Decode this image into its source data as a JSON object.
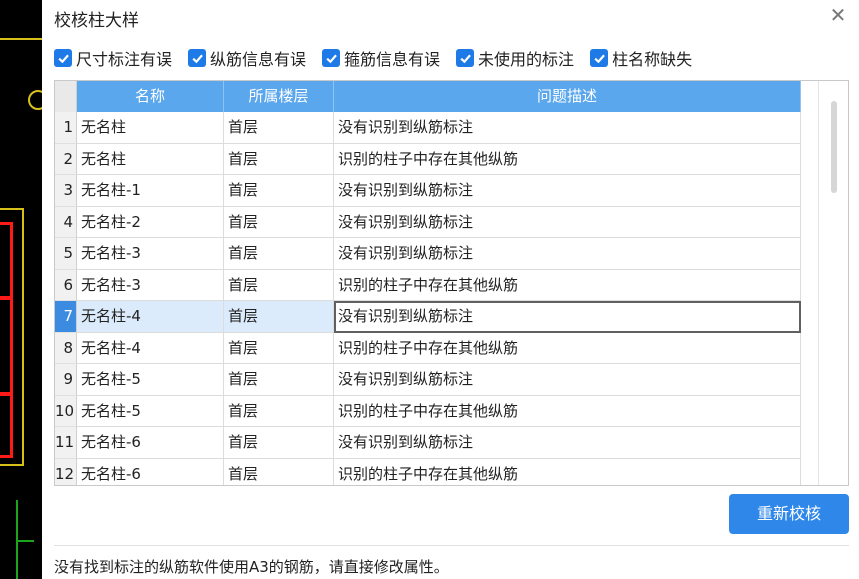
{
  "dialog": {
    "title": "校核柱大样",
    "close_glyph": "✕",
    "filters": [
      {
        "label": "尺寸标注有误",
        "checked": true
      },
      {
        "label": "纵筋信息有误",
        "checked": true
      },
      {
        "label": "箍筋信息有误",
        "checked": true
      },
      {
        "label": "未使用的标注",
        "checked": true
      },
      {
        "label": "柱名称缺失",
        "checked": true
      }
    ],
    "table": {
      "headers": [
        "名称",
        "所属楼层",
        "问题描述"
      ],
      "selected_row": 7,
      "rows": [
        {
          "num": "1",
          "name": "无名柱",
          "floor": "首层",
          "desc": "没有识别到纵筋标注"
        },
        {
          "num": "2",
          "name": "无名柱",
          "floor": "首层",
          "desc": "识别的柱子中存在其他纵筋"
        },
        {
          "num": "3",
          "name": "无名柱-1",
          "floor": "首层",
          "desc": "没有识别到纵筋标注"
        },
        {
          "num": "4",
          "name": "无名柱-2",
          "floor": "首层",
          "desc": "没有识别到纵筋标注"
        },
        {
          "num": "5",
          "name": "无名柱-3",
          "floor": "首层",
          "desc": "没有识别到纵筋标注"
        },
        {
          "num": "6",
          "name": "无名柱-3",
          "floor": "首层",
          "desc": "识别的柱子中存在其他纵筋"
        },
        {
          "num": "7",
          "name": "无名柱-4",
          "floor": "首层",
          "desc": "没有识别到纵筋标注"
        },
        {
          "num": "8",
          "name": "无名柱-4",
          "floor": "首层",
          "desc": "识别的柱子中存在其他纵筋"
        },
        {
          "num": "9",
          "name": "无名柱-5",
          "floor": "首层",
          "desc": "没有识别到纵筋标注"
        },
        {
          "num": "10",
          "name": "无名柱-5",
          "floor": "首层",
          "desc": "识别的柱子中存在其他纵筋"
        },
        {
          "num": "11",
          "name": "无名柱-6",
          "floor": "首层",
          "desc": "没有识别到纵筋标注"
        },
        {
          "num": "12",
          "name": "无名柱-6",
          "floor": "首层",
          "desc": "识别的柱子中存在其他纵筋"
        }
      ]
    },
    "recheck_button": "重新校核",
    "hint": "没有找到标注的纵筋软件使用A3的钢筋，请直接修改属性。"
  },
  "colors": {
    "accent": "#2f87ea",
    "header_bg": "#5aa7ee",
    "checkbox": "#1e7ae6",
    "selected_row_bg": "#dcebfb"
  },
  "icons": {
    "close": "close-icon",
    "checkbox": "checkmark-icon"
  }
}
